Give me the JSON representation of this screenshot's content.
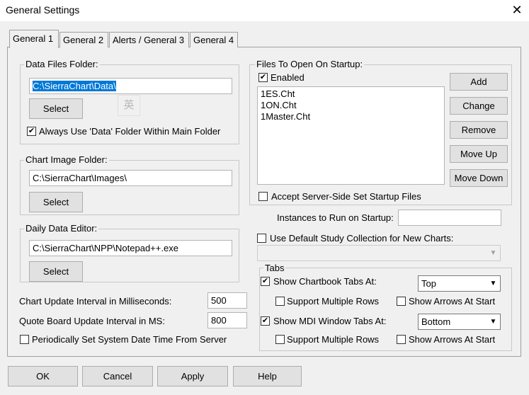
{
  "window": {
    "title": "General Settings",
    "close_glyph": "✕"
  },
  "tabs": [
    "General 1",
    "General 2",
    "Alerts / General 3",
    "General 4"
  ],
  "data_files": {
    "label": "Data Files Folder:",
    "value": "C:\\SierraChart\\Data\\",
    "select": "Select",
    "checkbox_label": "Always Use 'Data' Folder Within Main Folder",
    "checked": true
  },
  "ime_indicator": "英",
  "chart_image": {
    "label": "Chart Image Folder:",
    "value": "C:\\SierraChart\\Images\\",
    "select": "Select"
  },
  "daily_editor": {
    "label": "Daily Data Editor:",
    "value": "C:\\SierraChart\\NPP\\Notepad++.exe",
    "select": "Select"
  },
  "chart_update": {
    "label": "Chart Update Interval in Milliseconds:",
    "value": "500"
  },
  "quote_update": {
    "label": "Quote Board Update Interval in MS:",
    "value": "800"
  },
  "periodic_time": {
    "label": "Periodically Set System Date Time From Server",
    "checked": false
  },
  "startup_files": {
    "label": "Files To Open On Startup:",
    "enabled_label": "Enabled",
    "enabled": true,
    "files": [
      "1ES.Cht",
      "1ON.Cht",
      "1Master.Cht"
    ],
    "buttons": {
      "add": "Add",
      "change": "Change",
      "remove": "Remove",
      "move_up": "Move Up",
      "move_down": "Move Down"
    },
    "server_side_label": "Accept Server-Side Set Startup Files",
    "server_side_checked": false
  },
  "instances": {
    "label": "Instances to Run on Startup:",
    "value": ""
  },
  "default_study": {
    "label": "Use Default Study Collection for New Charts:",
    "checked": false,
    "value": ""
  },
  "tabs_group": {
    "label": "Tabs",
    "chartbook": {
      "label": "Show Chartbook Tabs At:",
      "checked": true,
      "position": "Top",
      "multi_rows_label": "Support Multiple Rows",
      "multi_rows": false,
      "arrows_label": "Show Arrows At Start",
      "arrows": false
    },
    "mdi": {
      "label": "Show MDI Window Tabs At:",
      "checked": true,
      "position": "Bottom",
      "multi_rows_label": "Support Multiple Rows",
      "multi_rows": false,
      "arrows_label": "Show Arrows At Start",
      "arrows": false
    }
  },
  "footer": {
    "ok": "OK",
    "cancel": "Cancel",
    "apply": "Apply",
    "help": "Help"
  },
  "glyphs": {
    "check": "✔",
    "dropdown": "▼"
  }
}
